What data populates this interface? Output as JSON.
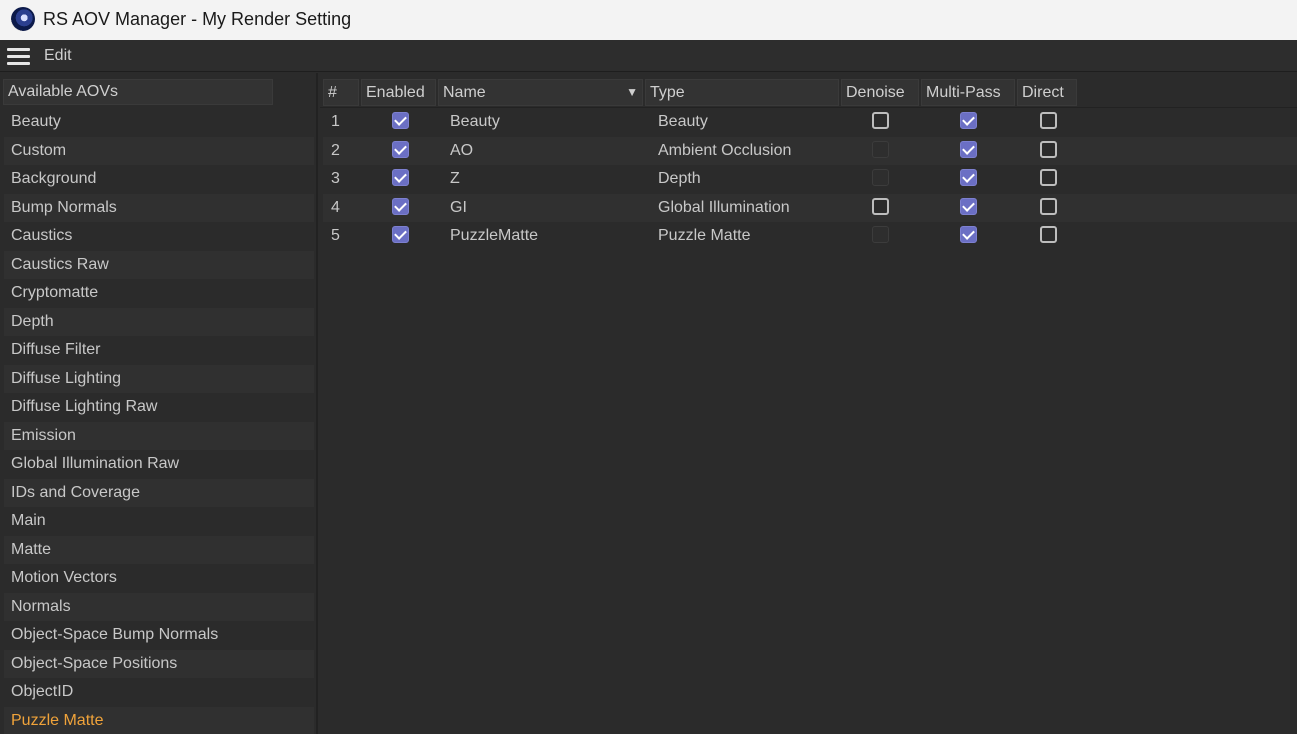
{
  "window": {
    "title": "RS AOV Manager - My Render Setting",
    "app_icon": "cinema4d-icon"
  },
  "menubar": {
    "menu_icon": "hamburger-icon",
    "edit_label": "Edit"
  },
  "left_panel": {
    "header": "Available AOVs",
    "items": [
      "Beauty",
      "Custom",
      "Background",
      "Bump Normals",
      "Caustics",
      "Caustics Raw",
      "Cryptomatte",
      "Depth",
      "Diffuse Filter",
      "Diffuse Lighting",
      "Diffuse Lighting Raw",
      "Emission",
      "Global Illumination Raw",
      "IDs and Coverage",
      "Main",
      "Matte",
      "Motion Vectors",
      "Normals",
      "Object-Space Bump Normals",
      "Object-Space Positions",
      "ObjectID",
      "Puzzle Matte"
    ],
    "selected": "Puzzle Matte",
    "selected_color": "#f0a33a"
  },
  "table": {
    "columns": {
      "num": "#",
      "enabled": "Enabled",
      "name": "Name",
      "type": "Type",
      "denoise": "Denoise",
      "multipass": "Multi-Pass",
      "direct": "Direct"
    },
    "sort_icon": "sort-down-arrow-icon",
    "rows": [
      {
        "num": "1",
        "enabled": "checked",
        "name": "Beauty",
        "type": "Beauty",
        "denoise": "unchecked",
        "multipass": "checked",
        "direct": "unchecked"
      },
      {
        "num": "2",
        "enabled": "checked",
        "name": "AO",
        "type": "Ambient Occlusion",
        "denoise": "disabled",
        "multipass": "checked",
        "direct": "unchecked"
      },
      {
        "num": "3",
        "enabled": "checked",
        "name": "Z",
        "type": "Depth",
        "denoise": "disabled",
        "multipass": "checked",
        "direct": "unchecked"
      },
      {
        "num": "4",
        "enabled": "checked",
        "name": "GI",
        "type": "Global Illumination",
        "denoise": "unchecked",
        "multipass": "checked",
        "direct": "unchecked"
      },
      {
        "num": "5",
        "enabled": "checked",
        "name": "PuzzleMatte",
        "type": "Puzzle Matte",
        "denoise": "disabled",
        "multipass": "checked",
        "direct": "unchecked"
      }
    ],
    "checkbox_color": "#6b6fc4"
  }
}
